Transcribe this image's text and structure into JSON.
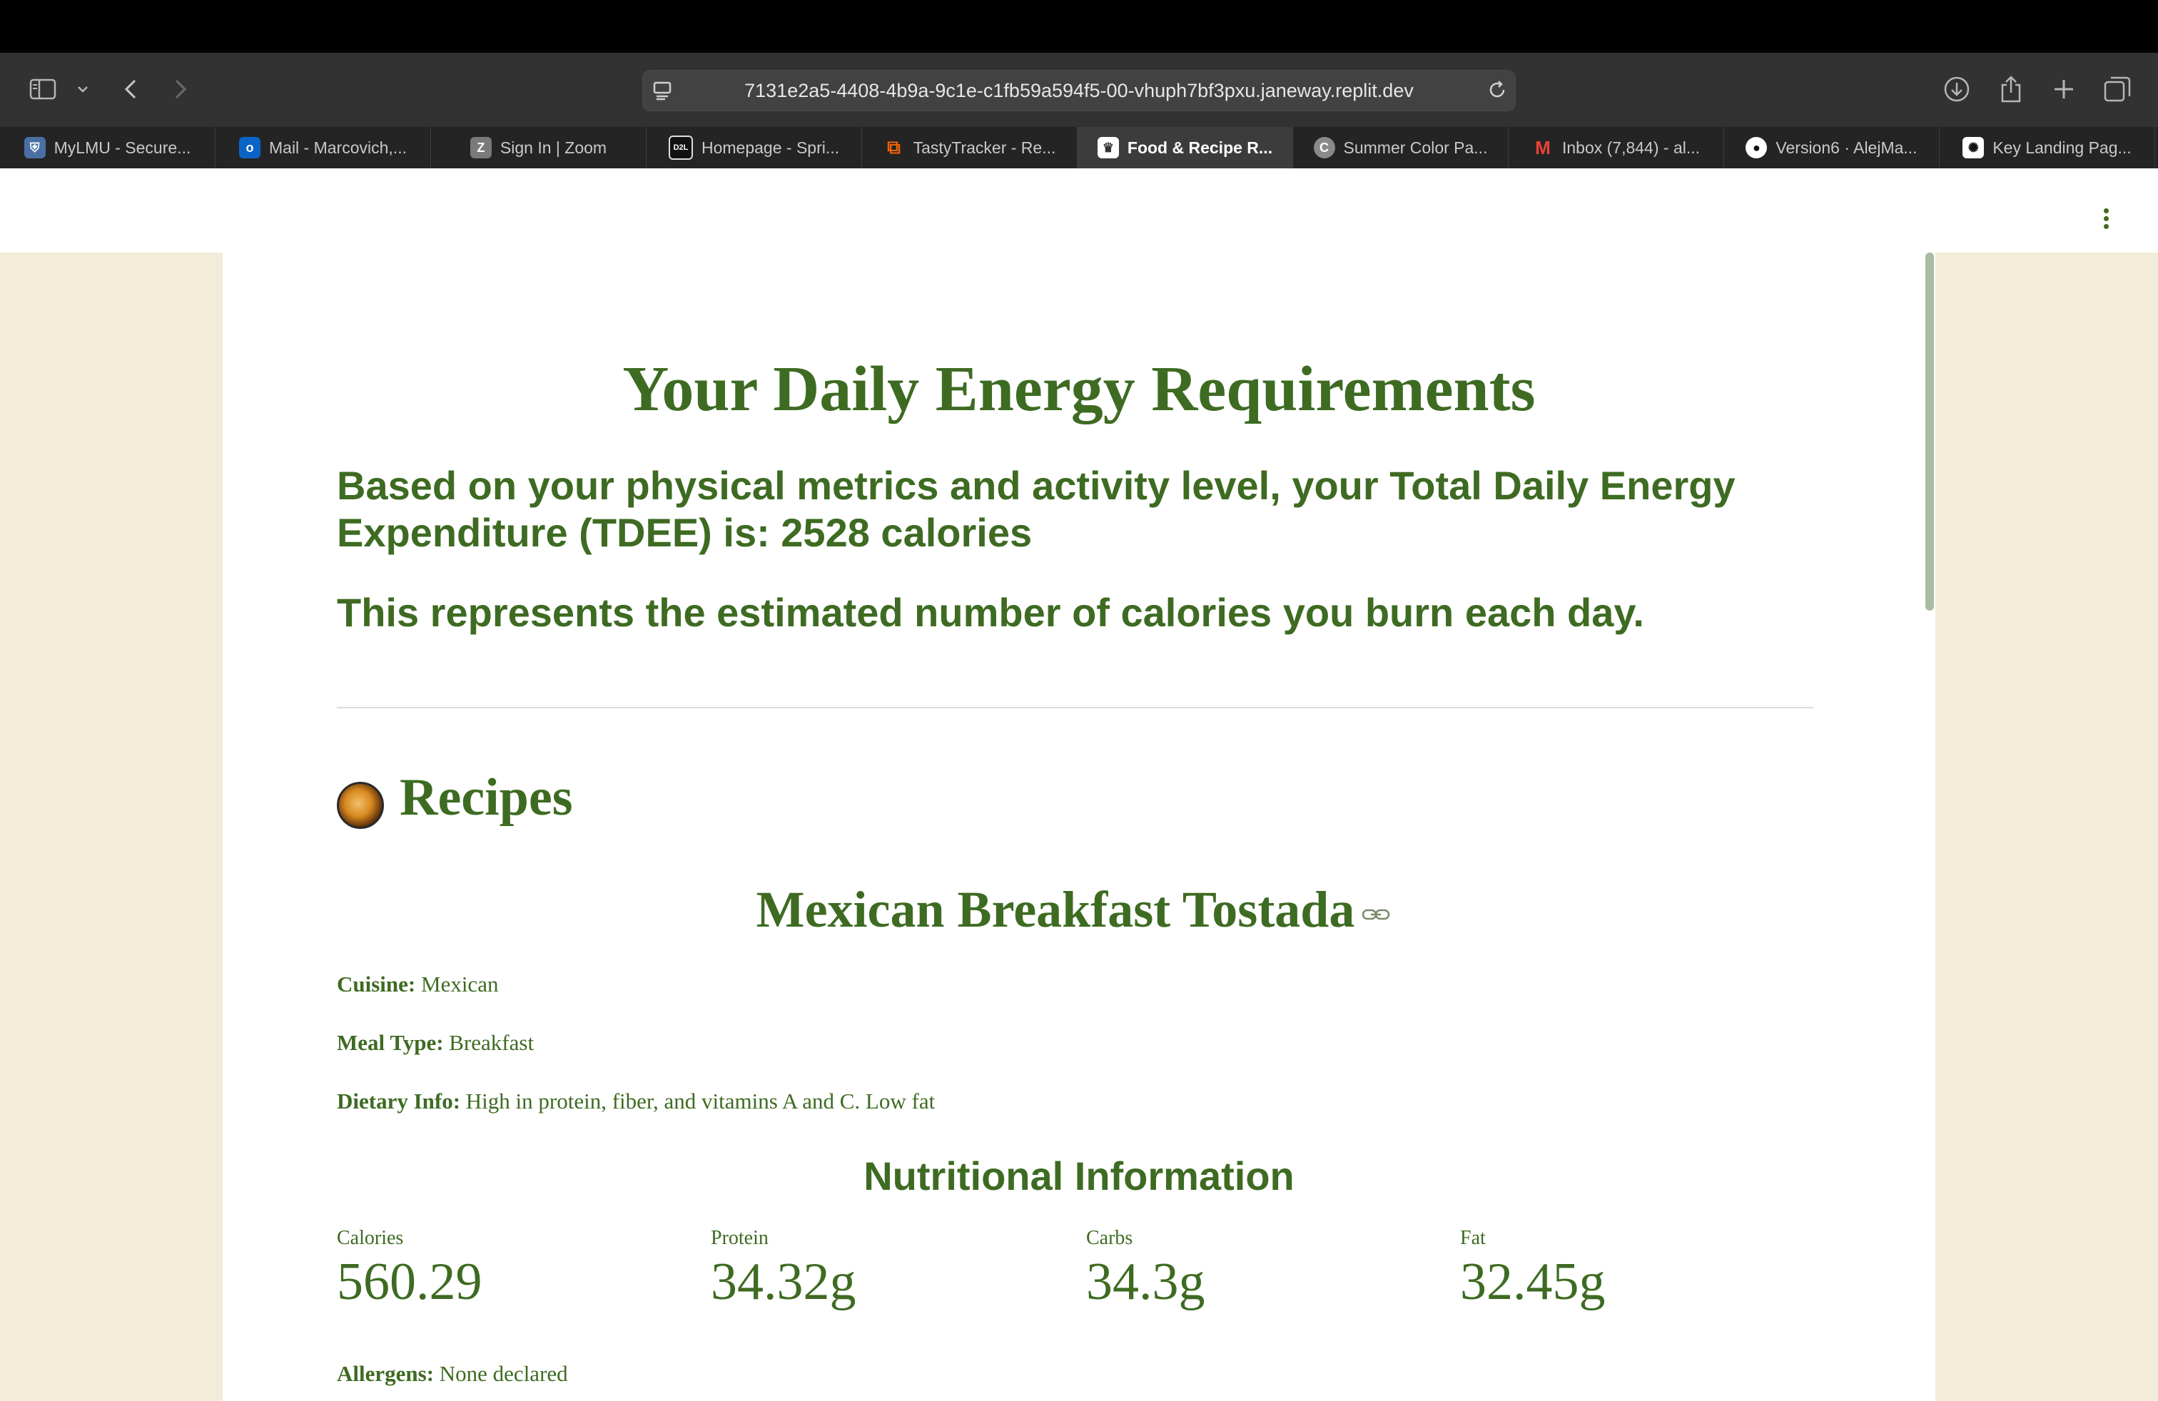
{
  "browser": {
    "url": "7131e2a5-4408-4b9a-9c1e-c1fb59a594f5-00-vhuph7bf3pxu.janeway.replit.dev",
    "tabs": [
      {
        "label": "MyLMU - Secure...",
        "icon": "shield-favicon",
        "color": "#4a6fa5"
      },
      {
        "label": "Mail - Marcovich,...",
        "icon": "outlook-favicon",
        "color": "#0a64c8"
      },
      {
        "label": "Sign In | Zoom",
        "icon": "zoom-favicon",
        "color": "#7a7a7a"
      },
      {
        "label": "Homepage - Spri...",
        "icon": "d2l-favicon",
        "color": "#111111"
      },
      {
        "label": "TastyTracker - Re...",
        "icon": "replit-favicon",
        "color": "#f26207"
      },
      {
        "label": "Food & Recipe R...",
        "icon": "crown-favicon",
        "color": "#ffffff",
        "active": true
      },
      {
        "label": "Summer Color Pa...",
        "icon": "coolors-favicon",
        "color": "#8a8a8a"
      },
      {
        "label": "Inbox (7,844) - al...",
        "icon": "gmail-favicon",
        "color": "#ea4335"
      },
      {
        "label": "Version6 · AlejMa...",
        "icon": "github-favicon",
        "color": "#ffffff"
      },
      {
        "label": "Key Landing Pag...",
        "icon": "openai-favicon",
        "color": "#ffffff"
      }
    ]
  },
  "page": {
    "title": "Your Daily Energy Requirements",
    "tdee_text": "Based on your physical metrics and activity level, your Total Daily Energy Expenditure (TDEE) is: 2528 calories",
    "tdee_note": "This represents the estimated number of calories you burn each day.",
    "recipes_heading": "Recipes",
    "recipe": {
      "name": "Mexican Breakfast Tostada",
      "cuisine_label": "Cuisine:",
      "cuisine": "Mexican",
      "meal_type_label": "Meal Type:",
      "meal_type": "Breakfast",
      "dietary_label": "Dietary Info:",
      "dietary": "High in protein, fiber, and vitamins A and C. Low fat",
      "nutrition_heading": "Nutritional Information",
      "nutrition": {
        "calories_label": "Calories",
        "calories": "560.29",
        "protein_label": "Protein",
        "protein": "34.32g",
        "carbs_label": "Carbs",
        "carbs": "34.3g",
        "fat_label": "Fat",
        "fat": "32.45g"
      },
      "allergens_label": "Allergens:",
      "allergens": "None declared"
    }
  },
  "colors": {
    "accent": "#3e6b22",
    "page_background": "#f2ecd8"
  }
}
